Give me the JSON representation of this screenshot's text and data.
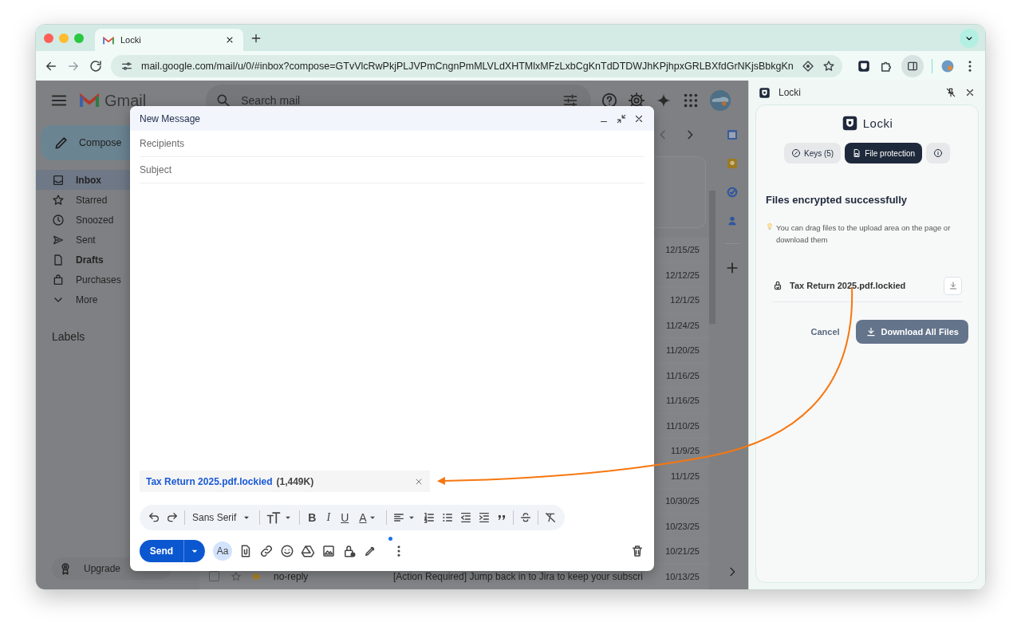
{
  "browser": {
    "tab_title": "Locki",
    "url": "mail.google.com/mail/u/0/#inbox?compose=GTvVlcRwPkjPLJVPmCngnPmMLVLdXHTMlxMFzLxbCgKnTdDTDWJhKPjhpxGRLBXfdGrNKjsBbkgKn"
  },
  "gmail": {
    "logo_text": "Gmail",
    "search": {
      "placeholder": "Search mail"
    },
    "compose_button": "Compose",
    "nav": [
      {
        "kind": "inbox",
        "label": "Inbox",
        "selected": true,
        "has_unread": true
      },
      {
        "kind": "starred",
        "label": "Starred",
        "selected": false,
        "has_unread": false
      },
      {
        "kind": "snoozed",
        "label": "Snoozed",
        "selected": false,
        "has_unread": false
      },
      {
        "kind": "sent",
        "label": "Sent",
        "selected": false,
        "has_unread": false
      },
      {
        "kind": "drafts",
        "label": "Drafts",
        "selected": false,
        "has_unread": true
      },
      {
        "kind": "purchases",
        "label": "Purchases",
        "selected": false,
        "has_unread": false
      },
      {
        "kind": "more",
        "label": "More",
        "selected": false,
        "has_unread": false
      }
    ],
    "labels_heading": "Labels",
    "upgrade": "Upgrade",
    "rows": [
      {
        "date": "12/15/25"
      },
      {
        "date": "12/12/25"
      },
      {
        "date": "12/1/25"
      },
      {
        "date": "11/24/25"
      },
      {
        "date": "11/20/25"
      },
      {
        "date": "11/16/25"
      },
      {
        "date": "11/16/25"
      },
      {
        "date": "11/10/25"
      },
      {
        "date": "11/9/25"
      },
      {
        "date": "11/1/25"
      },
      {
        "date": "10/30/25"
      },
      {
        "date": "10/23/25"
      },
      {
        "date": "10/21/25"
      },
      {
        "checked": false,
        "sender": "no-reply",
        "subject": "[Action Required] Jump back in to Jira to keep your subscri",
        "date": "10/13/25"
      }
    ]
  },
  "compose": {
    "title": "New Message",
    "recipients": {
      "placeholder": "Recipients"
    },
    "subject": {
      "placeholder": "Subject"
    },
    "attachment": {
      "name": "Tax Return 2025.pdf.lockied",
      "size": "(1,449K)"
    },
    "font": "Sans Serif",
    "format_glyphs": [
      {
        "kind": "bold",
        "glyph": "B"
      },
      {
        "kind": "italic",
        "glyph": "I"
      },
      {
        "kind": "underline",
        "glyph": "U"
      },
      {
        "kind": "color",
        "glyph": "A"
      }
    ],
    "formatting_button": {
      "glyph": "Aa",
      "on": true
    },
    "send": "Send",
    "more_options_notification": true
  },
  "side_panel": {
    "title": "Locki",
    "brand": "Locki",
    "tabs": [
      {
        "kind": "keys",
        "label": "Keys (5)",
        "selected": false
      },
      {
        "kind": "files",
        "label": "File protection",
        "selected": true
      },
      {
        "kind": "info",
        "selected": false
      }
    ],
    "heading": "Files encrypted successfully",
    "hint": "You can drag files to the upload area on the page or download them",
    "files": [
      {
        "name": "Tax Return 2025.pdf.lockied"
      }
    ],
    "cancel": "Cancel",
    "download_all": "Download All Files"
  }
}
